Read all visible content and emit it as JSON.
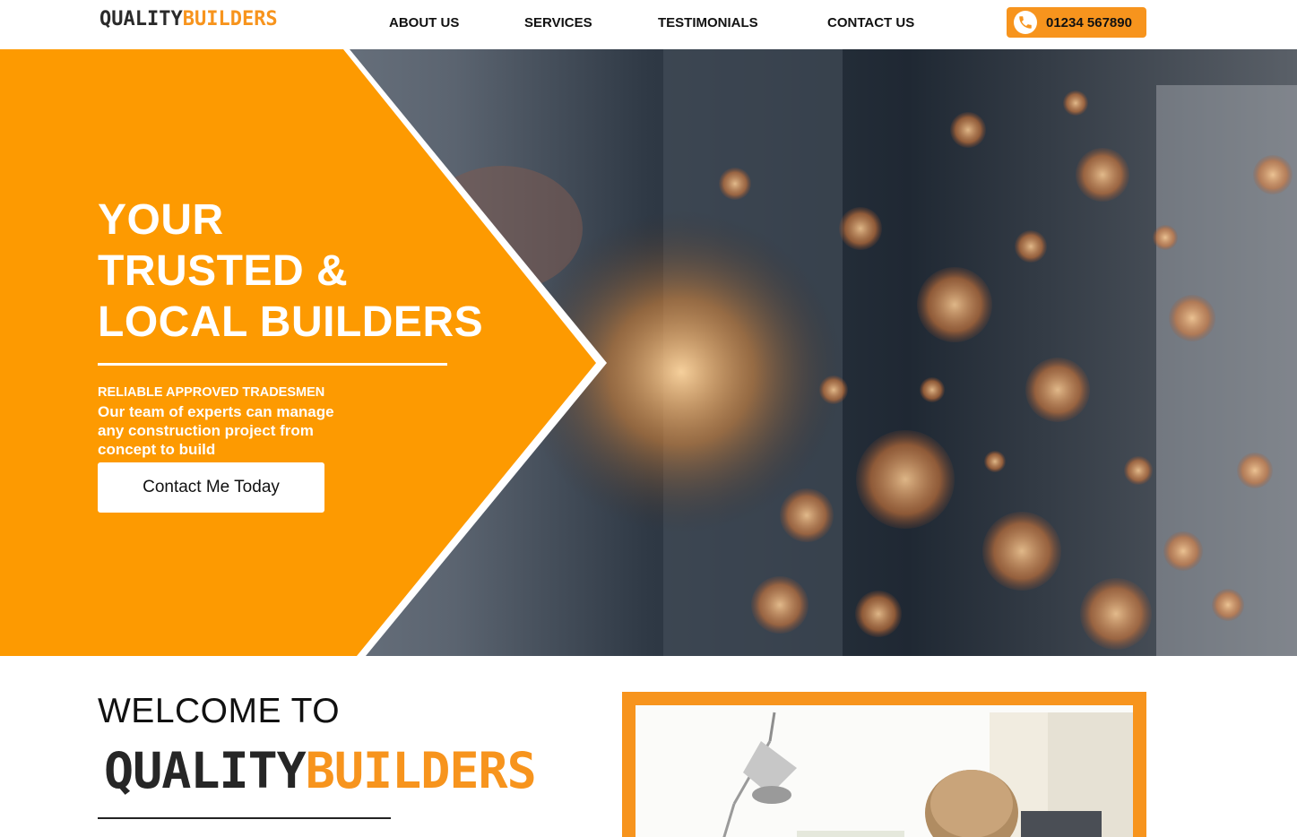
{
  "header": {
    "logo": {
      "part1": "QUALITY",
      "part2": "BUILDERS"
    },
    "nav": [
      {
        "label": "ABOUT US"
      },
      {
        "label": "SERVICES"
      },
      {
        "label": "TESTIMONIALS"
      },
      {
        "label": "CONTACT US"
      }
    ],
    "phone": {
      "icon": "phone-icon",
      "number": "01234 567890"
    }
  },
  "hero": {
    "title_lines": [
      "YOUR",
      "TRUSTED &",
      "LOCAL BUILDERS"
    ],
    "kicker": "RELIABLE APPROVED TRADESMEN",
    "description": "Our team of experts can manage any construction project from concept to build",
    "cta_label": "Contact Me Today"
  },
  "welcome": {
    "title": "WELCOME TO",
    "logo": {
      "part1": "QUALITY",
      "part2": "BUILDERS"
    }
  },
  "colors": {
    "accent": "#f7941d",
    "text": "#111111",
    "white": "#ffffff"
  }
}
